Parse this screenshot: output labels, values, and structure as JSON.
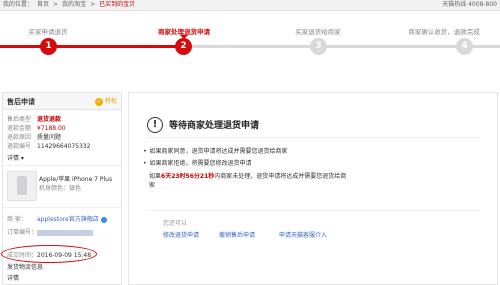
{
  "topbar": {
    "crumbs": [
      "我的位置：",
      "首页",
      ">",
      "我的淘宝",
      ">",
      "已买到的宝贝"
    ],
    "hotline": "天猫热线 4008-800"
  },
  "steps": [
    {
      "num": "1",
      "label": "买家申请退货",
      "state": "done"
    },
    {
      "num": "2",
      "label": "商家处理退货申请",
      "state": "active"
    },
    {
      "num": "3",
      "label": "买家退货给商家",
      "state": "todo"
    },
    {
      "num": "4",
      "label": "商家确认收货，退款完成",
      "state": "todo"
    }
  ],
  "aftersale": {
    "title": "售后申请",
    "vip_label": "特权",
    "type_label": "售后类型",
    "type_value": "退货退款",
    "amount_label": "退款金额",
    "amount_value": "¥7188.00",
    "reason_label": "退款原因",
    "reason_value": "质量问题",
    "no_label": "退款编号",
    "no_value": "11429664075332",
    "details": "详情",
    "product_name": "Apple/苹果 iPhone 7 Plus",
    "product_spec": "机身颜色：银色",
    "seller_label": "商  家：",
    "seller_value": "applestore官方旗舰店",
    "order_label": "订单编号：",
    "paytime_label": "成交时间：",
    "paytime_value": "2016-09-09 15:48",
    "shipping_label": "发货物流信息",
    "details2": "详情"
  },
  "status": {
    "title": "等待商家处理退货申请",
    "bullets": [
      "如果商家同意，退货申请将达成并需要您退货给商家",
      "如果商家拒绝，将需要您修改退货申请"
    ],
    "deadline_prefix": "如果",
    "deadline_highlight": "6天23时56分21秒",
    "deadline_suffix": "内商家未处理，退货申请将达成并需要您退货给商",
    "deadline_tail": "家",
    "options_label": "您还可以",
    "options": [
      "修改退货申请",
      "撤销售后申请",
      "申请天猫客服介入"
    ]
  }
}
